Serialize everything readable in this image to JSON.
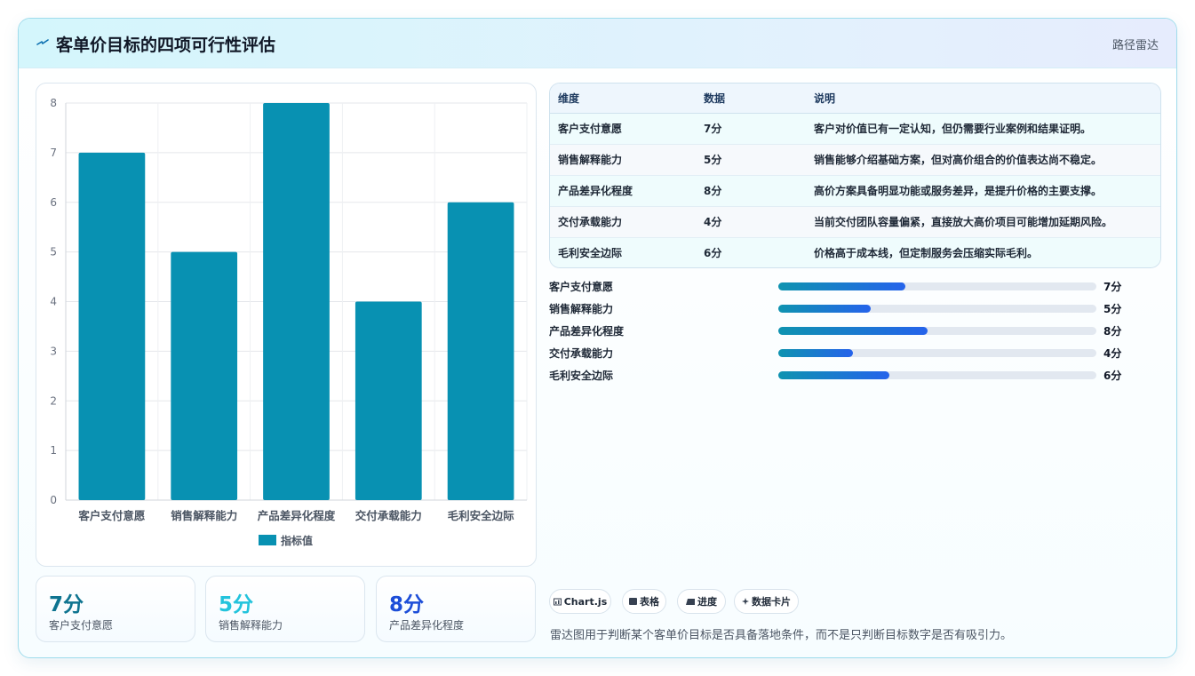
{
  "header": {
    "title": "客单价目标的四项可行性评估",
    "tag": "路径雷达",
    "logo_icon": "lightning-icon"
  },
  "chart_data": {
    "type": "bar",
    "categories": [
      "客户支付意愿",
      "销售解释能力",
      "产品差异化程度",
      "交付承载能力",
      "毛利安全边际"
    ],
    "series": [
      {
        "name": "指标值",
        "values": [
          7,
          5,
          8,
          4,
          6
        ]
      }
    ],
    "ylim": [
      0,
      8
    ],
    "yticks": [
      0,
      1,
      2,
      3,
      4,
      5,
      6,
      7,
      8
    ],
    "grid": true,
    "legend": "bottom",
    "color": "#0891b2"
  },
  "stats": [
    {
      "value": "7分",
      "label": "客户支付意愿",
      "color": "#0e7490"
    },
    {
      "value": "5分",
      "label": "销售解释能力",
      "color": "#22c3dc"
    },
    {
      "value": "8分",
      "label": "产品差异化程度",
      "color": "#1d4ed8"
    }
  ],
  "table": {
    "headers": [
      "维度",
      "数据",
      "说明"
    ],
    "rows": [
      [
        "客户支付意愿",
        "7分",
        "客户对价值已有一定认知，但仍需要行业案例和结果证明。"
      ],
      [
        "销售解释能力",
        "5分",
        "销售能够介绍基础方案，但对高价组合的价值表达尚不稳定。"
      ],
      [
        "产品差异化程度",
        "8分",
        "高价方案具备明显功能或服务差异，是提升价格的主要支撑。"
      ],
      [
        "交付承载能力",
        "4分",
        "当前交付团队容量偏紧，直接放大高价项目可能增加延期风险。"
      ],
      [
        "毛利安全边际",
        "6分",
        "价格高于成本线，但定制服务会压缩实际毛利。"
      ]
    ]
  },
  "progress": [
    {
      "label": "客户支付意愿",
      "value": "7分",
      "fraction": 0.4
    },
    {
      "label": "销售解释能力",
      "value": "5分",
      "fraction": 0.29
    },
    {
      "label": "产品差异化程度",
      "value": "8分",
      "fraction": 0.47
    },
    {
      "label": "交付承载能力",
      "value": "4分",
      "fraction": 0.235
    },
    {
      "label": "毛利安全边际",
      "value": "6分",
      "fraction": 0.35
    }
  ],
  "chips": [
    {
      "icon": "chart-icon",
      "label": "Chart.js"
    },
    {
      "icon": "table-icon",
      "label": "表格"
    },
    {
      "icon": "progress-icon",
      "label": "进度"
    },
    {
      "icon": "sparkle-icon",
      "label": "数据卡片"
    }
  ],
  "note": "雷达图用于判断某个客单价目标是否具备落地条件，而不是只判断目标数字是否有吸引力。"
}
